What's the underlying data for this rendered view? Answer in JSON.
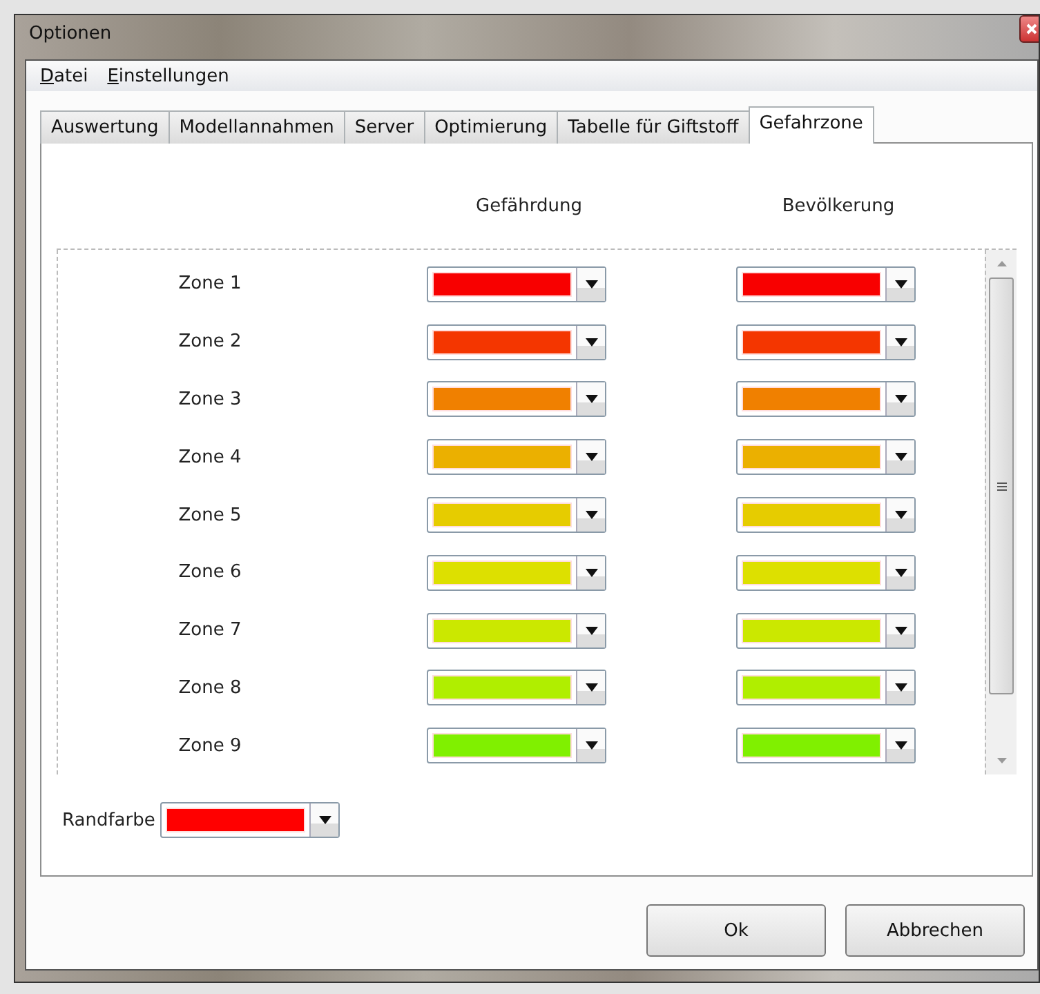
{
  "window": {
    "title": "Optionen"
  },
  "menu": [
    {
      "label": "Datei",
      "mnemonic_underlined": true
    },
    {
      "label": "Einstellungen",
      "mnemonic_underlined": true
    }
  ],
  "tabs": [
    {
      "label": "Auswertung",
      "selected": false
    },
    {
      "label": "Modellannahmen",
      "selected": false
    },
    {
      "label": "Server",
      "selected": false
    },
    {
      "label": "Optimierung",
      "selected": false
    },
    {
      "label": "Tabelle für Giftstoff",
      "selected": false
    },
    {
      "label": "Gefahrzone",
      "selected": true
    }
  ],
  "grid": {
    "columns": [
      "Gefährdung",
      "Bevölkerung"
    ],
    "rows": [
      {
        "label": "Zone 1",
        "cells": [
          {
            "color": "#f80000"
          },
          {
            "color": "#f80000"
          }
        ]
      },
      {
        "label": "Zone 2",
        "cells": [
          {
            "color": "#f43600"
          },
          {
            "color": "#f43600"
          }
        ]
      },
      {
        "label": "Zone 3",
        "cells": [
          {
            "color": "#f08000"
          },
          {
            "color": "#f08000"
          }
        ]
      },
      {
        "label": "Zone 4",
        "cells": [
          {
            "color": "#ebb000"
          },
          {
            "color": "#ebb000"
          }
        ]
      },
      {
        "label": "Zone 5",
        "cells": [
          {
            "color": "#e6cc00"
          },
          {
            "color": "#e6cc00"
          }
        ]
      },
      {
        "label": "Zone 6",
        "cells": [
          {
            "color": "#dde000"
          },
          {
            "color": "#dde000"
          }
        ]
      },
      {
        "label": "Zone 7",
        "cells": [
          {
            "color": "#cbe800"
          },
          {
            "color": "#cbe800"
          }
        ]
      },
      {
        "label": "Zone 8",
        "cells": [
          {
            "color": "#b0ee00"
          },
          {
            "color": "#b0ee00"
          }
        ]
      },
      {
        "label": "Zone 9",
        "cells": [
          {
            "color": "#80f000"
          },
          {
            "color": "#80f000"
          }
        ]
      }
    ]
  },
  "border_color": {
    "label": "Randfarbe",
    "color": "#ff0000"
  },
  "buttons": [
    "Ok",
    "Abbrechen"
  ]
}
